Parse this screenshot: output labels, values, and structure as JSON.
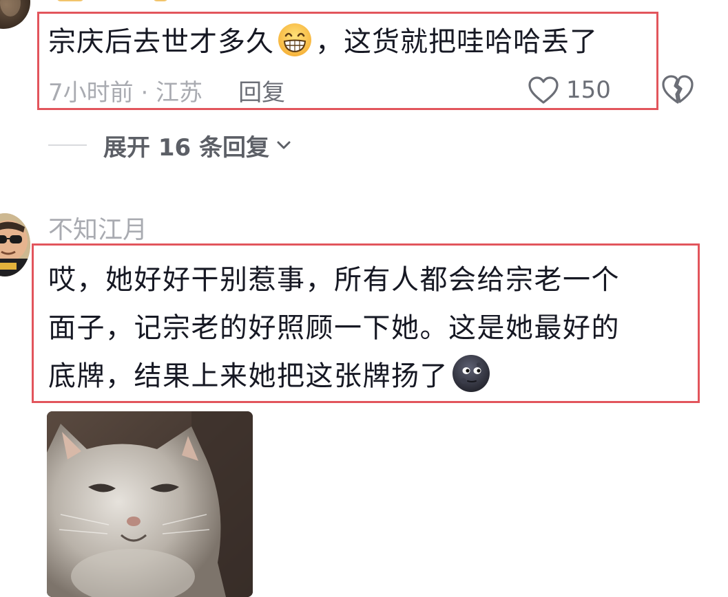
{
  "comment_1": {
    "text_before_emoji": "宗庆后去世才多久",
    "emoji": "grinning-face-icon",
    "text_after_emoji": "，这货就把哇哈哈丢了",
    "time_location": "7小时前 · 江苏",
    "reply_label": "回复",
    "like_count": "150"
  },
  "replies": {
    "expand_label": "展开 16 条回复"
  },
  "comment_2": {
    "username": "不知江月",
    "lines": [
      "哎，她好好干别惹事，所有人都会给宗老一个",
      "面子，记宗老的好照顾一下她。这是她最好的",
      "底牌，结果上来她把这张牌扬了"
    ],
    "emoji": "new-moon-face-icon",
    "sticker": "cat-sticker-image"
  },
  "colors": {
    "highlight_border": "#e2555c",
    "text_primary": "#161823",
    "text_secondary": "#a9abb1",
    "text_tertiary": "#6b6e76"
  }
}
